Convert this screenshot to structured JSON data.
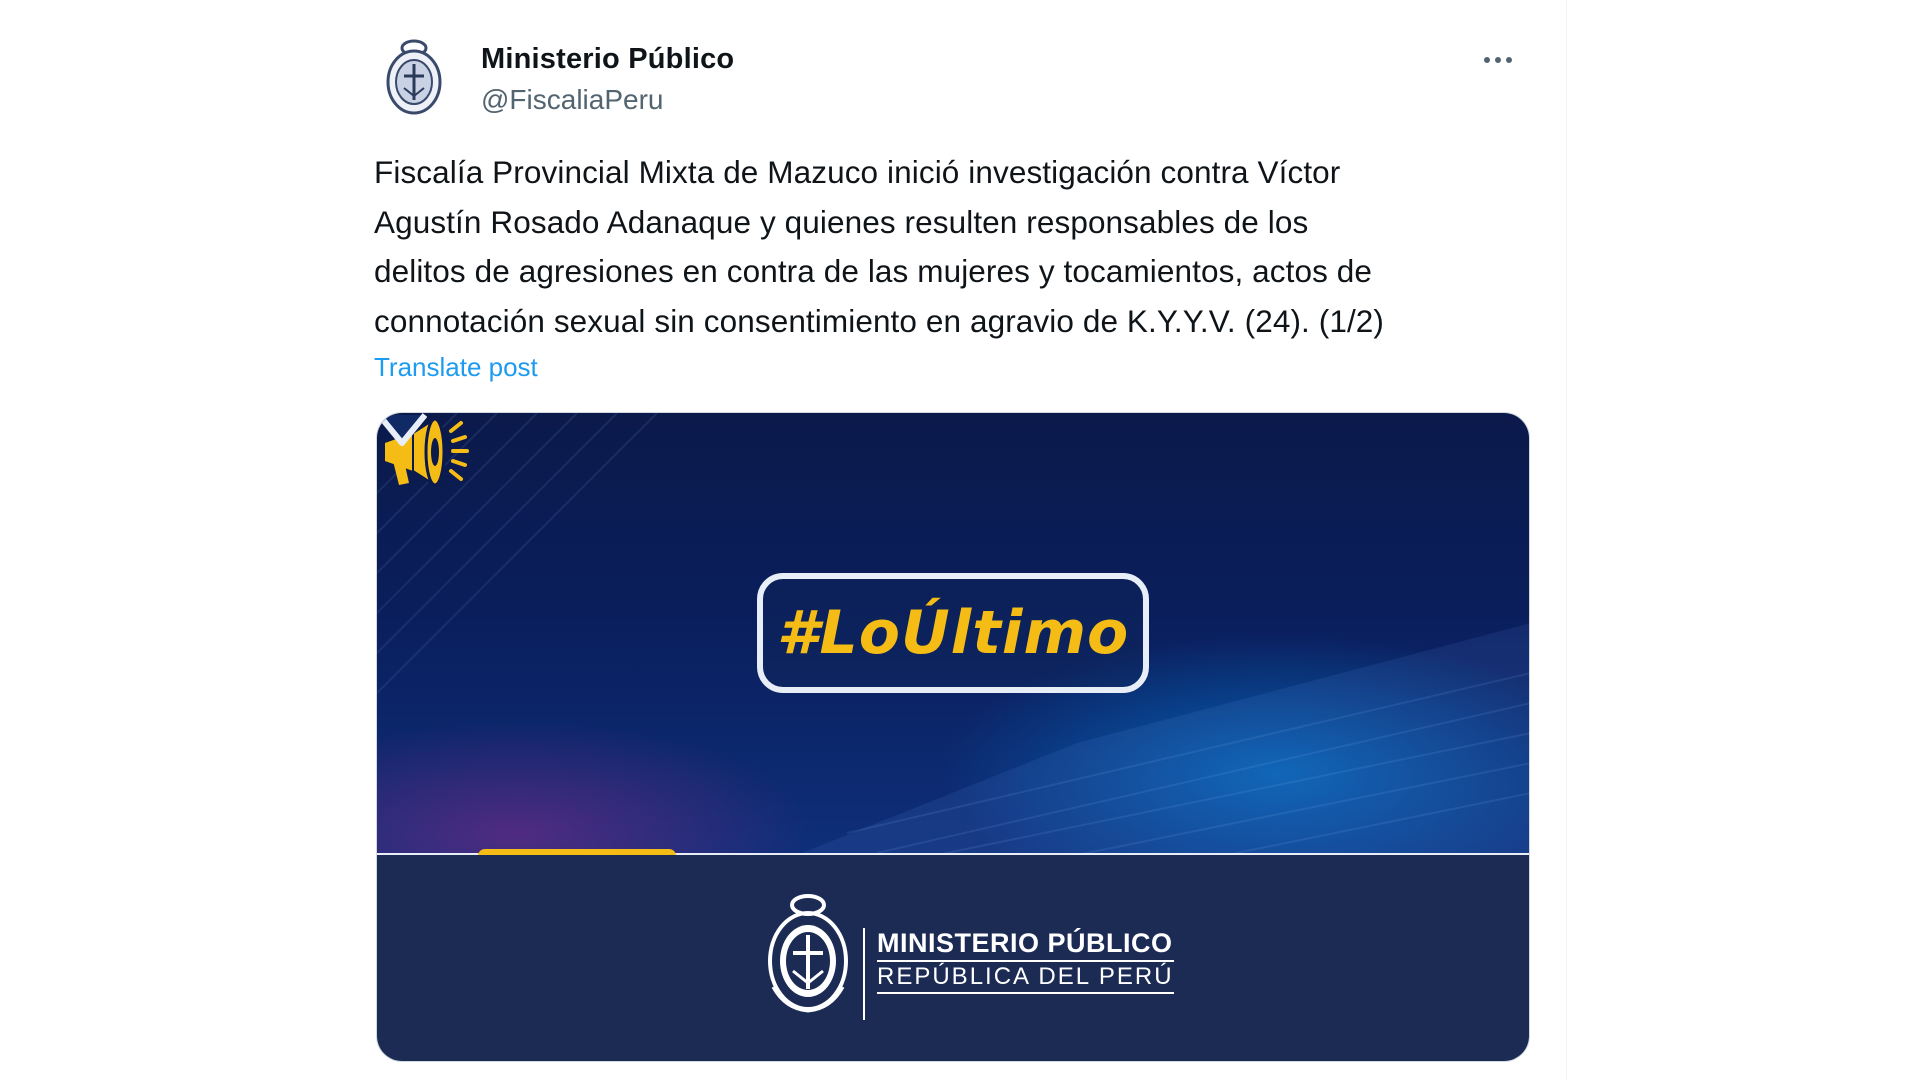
{
  "author": {
    "display_name": "Ministerio Público",
    "handle": "@FiscaliaPeru",
    "avatar_icon": "ministerio-publico-seal-icon"
  },
  "more_icon": "more-horizontal-icon",
  "post": {
    "lines": [
      "Fiscalía Provincial Mixta de Mazuco inició investigación contra Víctor",
      "Agustín Rosado Adanaque y quienes resulten responsables de los",
      "delitos de agresiones en contra de las mujeres y tocamientos, actos de",
      "connotación sexual sin consentimiento en agravio de K.Y.Y.V. (24). (1/2)"
    ],
    "translate_label": "Translate post"
  },
  "media": {
    "hashtag": "#LoÚltimo",
    "org_line1": "MINISTERIO PÚBLICO",
    "org_line2": "REPÚBLICA DEL PERÚ",
    "accent_color": "#f5bc15",
    "top_color": "#0b1a4a",
    "bottom_color": "#1b2b54",
    "icons": [
      "megaphone-icon",
      "ministerio-publico-seal-icon"
    ]
  }
}
